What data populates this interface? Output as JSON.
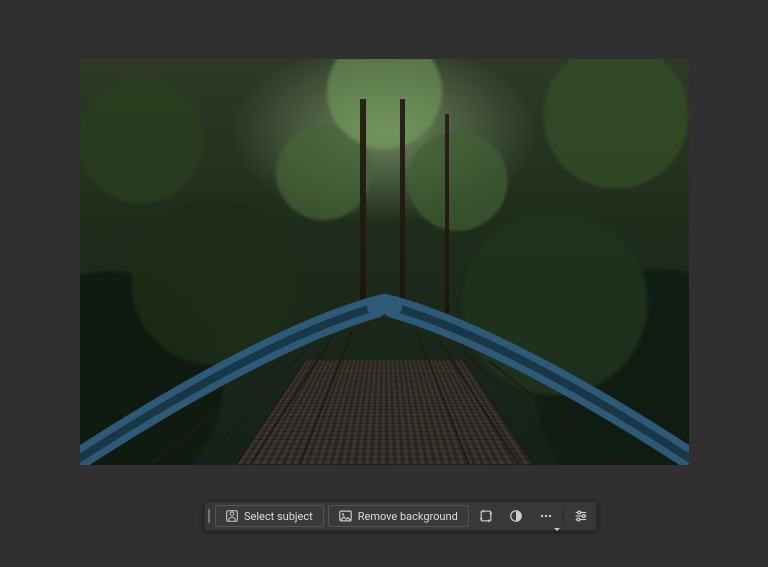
{
  "toolbar": {
    "select_subject_label": "Select subject",
    "remove_background_label": "Remove background",
    "icons": {
      "person": "person-icon",
      "image": "image-icon",
      "crop": "crop-transform-icon",
      "mask": "mask-circle-icon",
      "more": "more-options-icon",
      "properties": "properties-sliders-icon"
    }
  },
  "colors": {
    "app_background": "#303030",
    "toolbar_background": "#383838",
    "button_border": "#555555",
    "text": "#dddddd"
  }
}
